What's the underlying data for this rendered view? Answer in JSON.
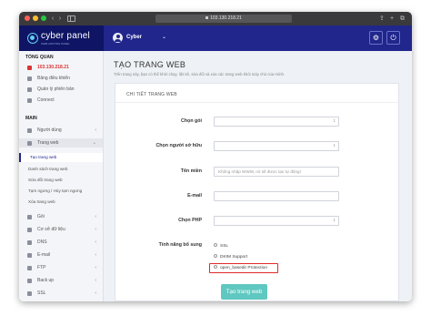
{
  "browser": {
    "url": "103.130.218.21",
    "back": "‹",
    "forward": "›",
    "share": "⇪",
    "new_tab": "+",
    "tabs": "⧉"
  },
  "brand": {
    "name": "cyber panel",
    "tagline": "WEB HOSTING PANEL"
  },
  "user": {
    "name": "Cyber",
    "caret": "⌄"
  },
  "topbar": {
    "settings_glyph": "⚙",
    "power_glyph": "⏻"
  },
  "sidebar": {
    "overview_heading": "TỔNG QUAN",
    "overview_items": [
      {
        "label": "103.130.218.21",
        "icon": "monitor-icon"
      },
      {
        "label": "Bảng điều khiển",
        "icon": "dashboard-icon"
      },
      {
        "label": "Quản lý phiên bản",
        "icon": "info-icon"
      },
      {
        "label": "Connect",
        "icon": "link-icon"
      }
    ],
    "main_heading": "MAIN",
    "main_items": [
      {
        "label": "Người dùng",
        "icon": "users-icon",
        "chevron": "‹"
      },
      {
        "label": "Trang web",
        "icon": "globe-icon",
        "chevron": "⌄"
      }
    ],
    "website_subitems": [
      "Tạo trang web",
      "Danh sách trang web",
      "Sửa đổi trang web",
      "Tạm ngưng / Hủy tạm ngưng",
      "Xóa trang web"
    ],
    "more_items": [
      {
        "label": "Gói",
        "icon": "package-icon",
        "chevron": "‹"
      },
      {
        "label": "Cơ sở dữ liệu",
        "icon": "database-icon",
        "chevron": "‹"
      },
      {
        "label": "DNS",
        "icon": "dns-icon",
        "chevron": "‹"
      },
      {
        "label": "E-mail",
        "icon": "email-icon",
        "chevron": "‹"
      },
      {
        "label": "FTP",
        "icon": "ftp-icon",
        "chevron": "‹"
      },
      {
        "label": "Back up",
        "icon": "backup-icon",
        "chevron": "‹"
      },
      {
        "label": "SSL",
        "icon": "ssl-icon",
        "chevron": "‹"
      }
    ]
  },
  "main": {
    "title": "TẠO TRANG WEB",
    "subtitle": "Trên trang này, bạn có thể khởi chạy, liệt kê, sửa đổi và xóa các trang web khỏi máy chủ của mình.",
    "card_title": "CHI TIẾT TRANG WEB",
    "fields": {
      "package_label": "Chọn gói",
      "owner_label": "Chọn người sở hữu",
      "domain_label": "Tên miền",
      "domain_placeholder": "Không nhập WWW, nó sẽ được tạo tự động!",
      "email_label": "E-mail",
      "php_label": "Chọn PHP",
      "features_label": "Tính năng bổ sung"
    },
    "features": [
      "SSL",
      "DKIM Support",
      "open_basedir Protection"
    ],
    "submit_label": "Tạo trang web"
  },
  "colors": {
    "topbar": "#20268b",
    "brand_bg": "#0f1564",
    "submit": "#5fc8c0",
    "highlight": "#e02a2a"
  }
}
